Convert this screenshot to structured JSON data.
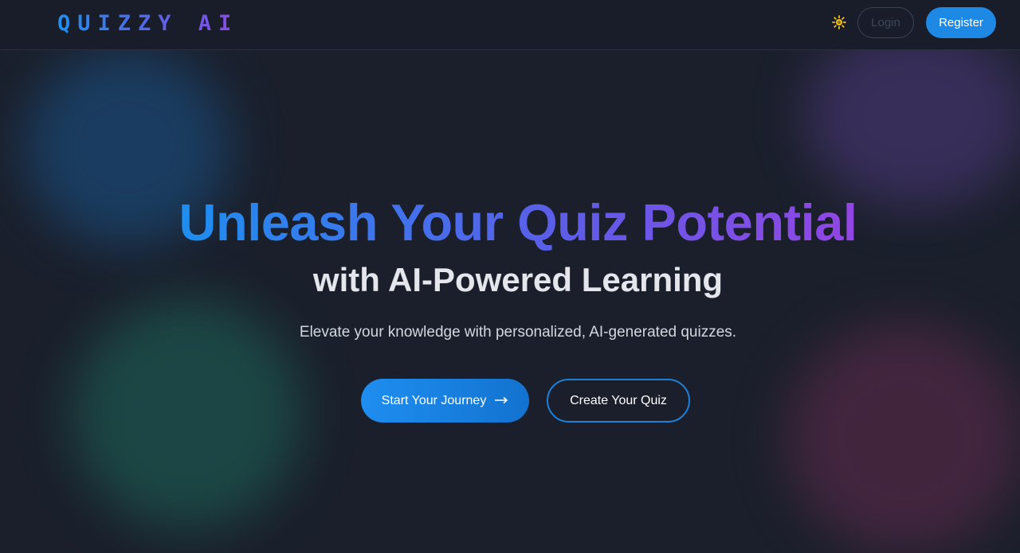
{
  "header": {
    "logo": "QUIZZY AI",
    "theme_toggle_icon": "sun-icon",
    "login_label": "Login",
    "register_label": "Register"
  },
  "hero": {
    "title": "Unleash Your Quiz Potential",
    "subtitle": "with AI-Powered Learning",
    "description": "Elevate your knowledge with personalized, AI-generated quizzes.",
    "primary_button_label": "Start Your Journey",
    "primary_button_icon": "arrow-right-icon",
    "secondary_button_label": "Create Your Quiz"
  },
  "colors": {
    "background": "#1a1f2b",
    "accent_blue": "#1e88e5",
    "accent_purple": "#9345e4",
    "sun": "#f5c518"
  }
}
